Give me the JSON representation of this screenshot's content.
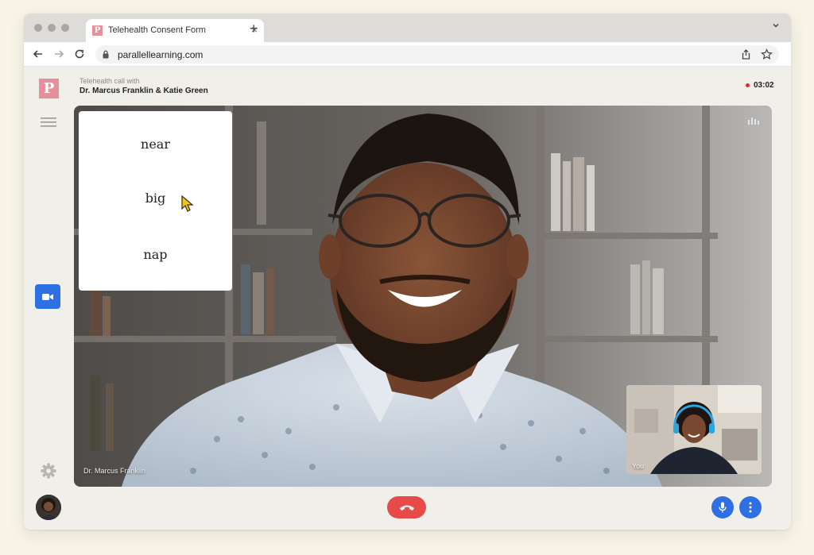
{
  "browser": {
    "tab": {
      "title": "Telehealth Consent Form",
      "favicon_letter": "P",
      "close_glyph": "×"
    },
    "new_tab_glyph": "+",
    "url": "parallellearning.com"
  },
  "app": {
    "logo_letter": "P",
    "header": {
      "call_with_label": "Telehealth call with",
      "participants": "Dr. Marcus Franklin & Katie Green",
      "timer": "03:02"
    },
    "word_card": {
      "words": [
        "near",
        "big",
        "nap"
      ]
    },
    "main_video": {
      "participant_name": "Dr. Marcus Franklin"
    },
    "self_view": {
      "label": "You"
    }
  },
  "colors": {
    "accent": "#2f6fe4",
    "brand": "#e8909a",
    "end_call": "#e84a4a",
    "recording": "#e02b2b"
  },
  "icons": {
    "sidebar": [
      "menu-icon",
      "video-camera-icon",
      "gear-icon"
    ],
    "toolbar": [
      "back-arrow-icon",
      "forward-arrow-icon",
      "reload-icon",
      "lock-icon",
      "share-icon",
      "star-icon"
    ],
    "controls": [
      "end-call-icon",
      "microphone-icon",
      "more-vertical-icon"
    ]
  }
}
